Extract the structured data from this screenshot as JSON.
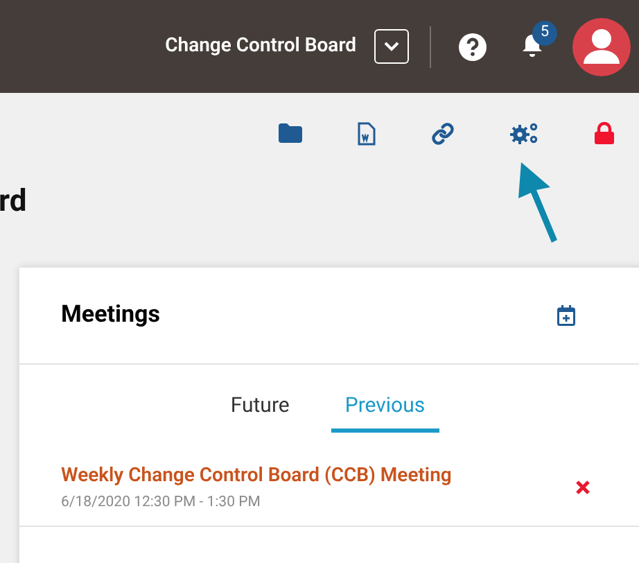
{
  "header": {
    "board_name": "Change Control Board",
    "notification_count": "5"
  },
  "toolbar": {
    "icons": [
      {
        "kind": "folder"
      },
      {
        "kind": "word"
      },
      {
        "kind": "link"
      },
      {
        "kind": "settings"
      },
      {
        "kind": "lock"
      }
    ]
  },
  "page_title": "rd",
  "meetings": {
    "title": "Meetings",
    "tabs": [
      {
        "label": "Future",
        "selected": false
      },
      {
        "label": "Previous",
        "selected": true
      }
    ],
    "items": [
      {
        "title": "Weekly Change Control Board (CCB) Meeting",
        "time": "6/18/2020 12:30 PM - 1:30 PM"
      }
    ]
  }
}
